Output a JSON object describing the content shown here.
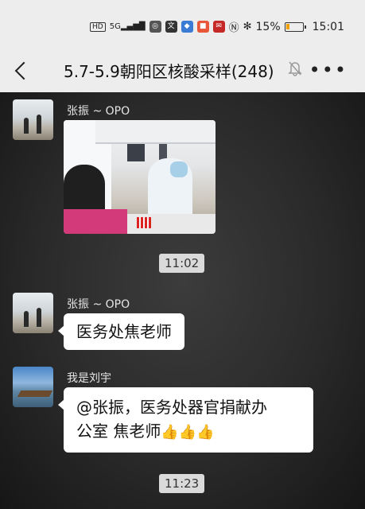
{
  "status_bar": {
    "percent": "15%",
    "time": "15:01",
    "left_icons": [
      "HD",
      "5G",
      "signal-icon"
    ]
  },
  "header": {
    "title": "5.7-5.9朝阳区核酸采样(248)"
  },
  "messages": [
    {
      "sender": "张振 ~ OPO",
      "type": "image",
      "image_desc": ""
    },
    {
      "time": "11:02"
    },
    {
      "sender": "张振 ~ OPO",
      "type": "text",
      "text": "医务处焦老师"
    },
    {
      "sender": "我是刘宇",
      "type": "text",
      "text_line1": "@张振，医务处器官捐献办",
      "text_line2": "公室  焦老师",
      "emoji": "👍👍👍"
    },
    {
      "time": "11:23"
    }
  ],
  "colors": {
    "bubble": "#ffffff",
    "header_bg": "#ededed",
    "time_pill": "#dadada"
  }
}
